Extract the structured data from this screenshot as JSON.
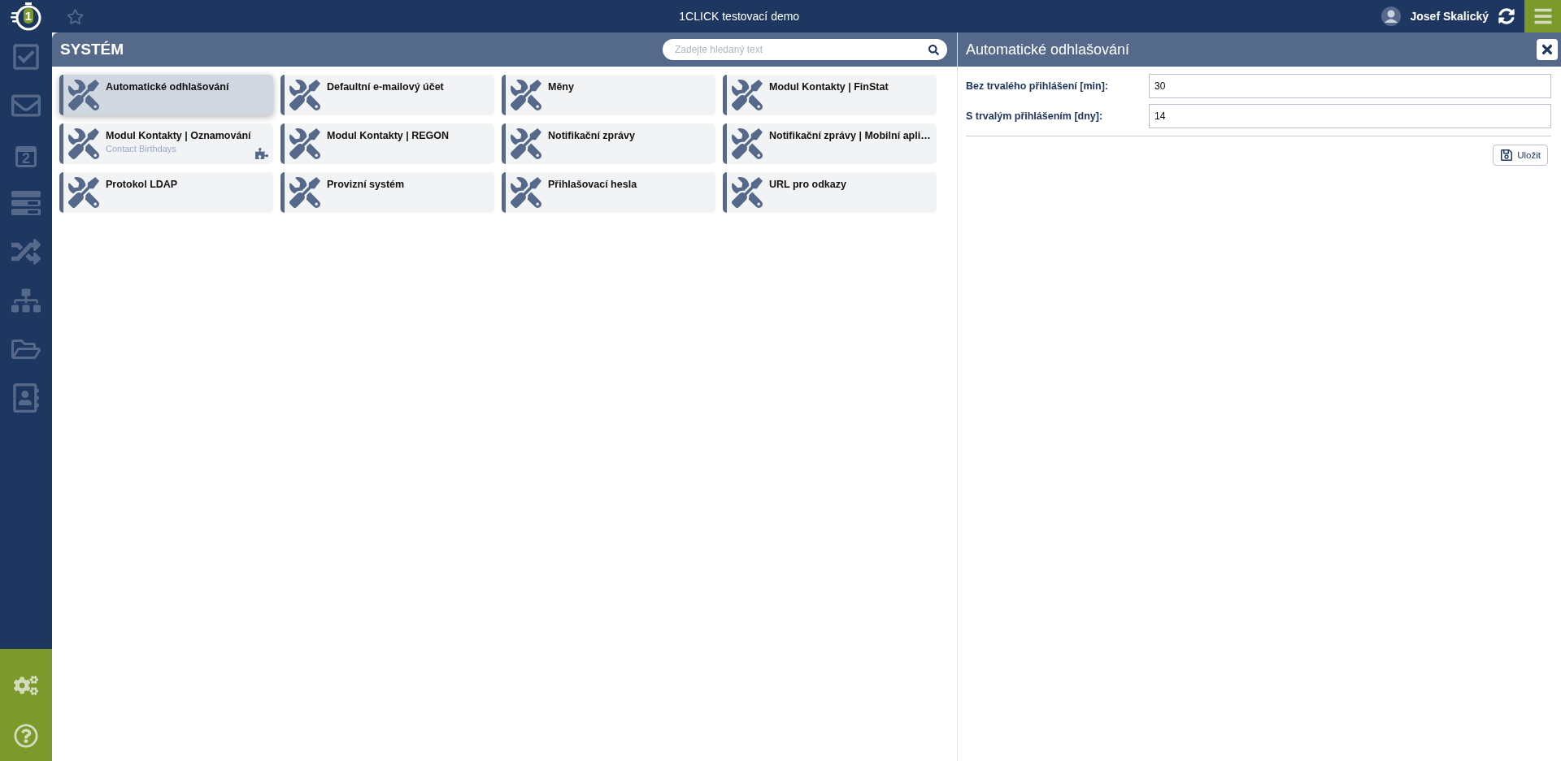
{
  "app": {
    "title": "1CLICK testovací demo",
    "logo_digit": "1",
    "user": "Josef Skalický"
  },
  "sidebar": {
    "items": [
      {
        "kind": "tasks"
      },
      {
        "kind": "mail"
      },
      {
        "kind": "calendar",
        "badge": "2"
      },
      {
        "kind": "list"
      },
      {
        "kind": "workflow"
      },
      {
        "kind": "structure"
      },
      {
        "kind": "folder"
      },
      {
        "kind": "contacts"
      }
    ],
    "bottom_items": [
      {
        "kind": "settings"
      },
      {
        "kind": "help"
      }
    ]
  },
  "list_panel": {
    "title": "SYSTÉM",
    "search": {
      "placeholder": "Zadejte hledaný text"
    },
    "tiles": [
      {
        "title": "Automatické odhlašování",
        "selected": true,
        "plugin": false
      },
      {
        "title": "Defaultní e-mailový účet",
        "selected": false,
        "plugin": false
      },
      {
        "title": "Měny",
        "selected": false,
        "plugin": false
      },
      {
        "title": "Modul Kontakty | FinStat",
        "selected": false,
        "plugin": false
      },
      {
        "title": "Modul Kontakty | Oznamování",
        "subtitle": "Contact Birthdays",
        "selected": false,
        "plugin": true
      },
      {
        "title": "Modul Kontakty | REGON",
        "selected": false,
        "plugin": false
      },
      {
        "title": "Notifikační zprávy",
        "selected": false,
        "plugin": false
      },
      {
        "title": "Notifikační zprávy | Mobilní apli…",
        "selected": false,
        "plugin": false
      },
      {
        "title": "Protokol LDAP",
        "selected": false,
        "plugin": false
      },
      {
        "title": "Provizní systém",
        "selected": false,
        "plugin": false
      },
      {
        "title": "Přihlašovací hesla",
        "selected": false,
        "plugin": false
      },
      {
        "title": "URL pro odkazy",
        "selected": false,
        "plugin": false
      }
    ]
  },
  "detail_panel": {
    "title": "Automatické odhlašování",
    "fields": [
      {
        "label": "Bez trvalého přihlášení [min]:",
        "value": "30"
      },
      {
        "label": "S trvalým přihlášením [dny]:",
        "value": "14"
      }
    ],
    "save_button": "Uložit"
  }
}
